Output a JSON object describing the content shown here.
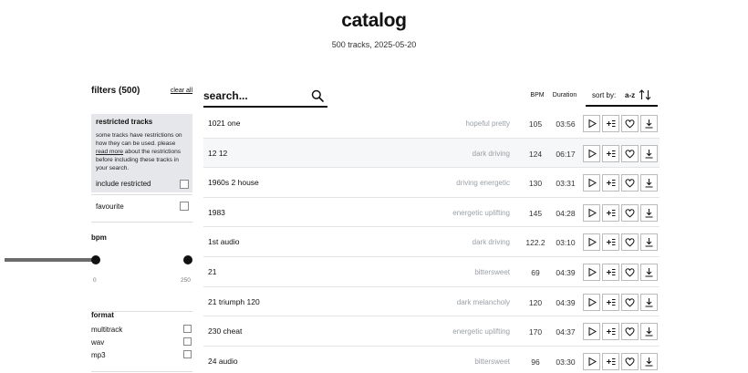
{
  "header": {
    "title": "catalog",
    "subtitle": "500 tracks, 2025-05-20"
  },
  "sidebar": {
    "filters_title": "filters (500)",
    "clear_all": "clear all",
    "restricted": {
      "title": "restricted tracks",
      "text_before": "some tracks have restrictions on how they can be used. please ",
      "link": "read more",
      "text_after": " about the restrictions before including these tracks in your search.",
      "include_label": "include restricted"
    },
    "favourite_label": "favourite",
    "bpm": {
      "title": "bpm",
      "min_label": "0",
      "max_label": "250",
      "range": [
        0,
        250
      ]
    },
    "format": {
      "title": "format",
      "options": [
        "multitrack",
        "wav",
        "mp3"
      ]
    }
  },
  "main": {
    "search_placeholder": "search...",
    "columns": {
      "bpm": "BPM",
      "duration": "Duration"
    },
    "sort": {
      "by_label": "sort by:",
      "value": "a-z"
    },
    "tracks": [
      {
        "name": "1021 one",
        "tags": "hopeful pretty",
        "bpm": "105",
        "duration": "03:56"
      },
      {
        "name": "12 12",
        "tags": "dark driving",
        "bpm": "124",
        "duration": "06:17"
      },
      {
        "name": "1960s 2 house",
        "tags": "driving energetic",
        "bpm": "130",
        "duration": "03:31"
      },
      {
        "name": "1983",
        "tags": "energetic uplifting",
        "bpm": "145",
        "duration": "04:28"
      },
      {
        "name": "1st audio",
        "tags": "dark driving",
        "bpm": "122.2",
        "duration": "03:10"
      },
      {
        "name": "21",
        "tags": "bittersweet",
        "bpm": "69",
        "duration": "04:39"
      },
      {
        "name": "21 triumph 120",
        "tags": "dark melancholy",
        "bpm": "120",
        "duration": "04:39"
      },
      {
        "name": "230 cheat",
        "tags": "energetic uplifting",
        "bpm": "170",
        "duration": "04:37"
      },
      {
        "name": "24 audio",
        "tags": "bittersweet",
        "bpm": "96",
        "duration": "03:30"
      }
    ]
  },
  "icons": {
    "search": "search-icon",
    "sort": "sort-arrows-icon",
    "play": "play-icon",
    "add_to_list": "add-to-list-icon",
    "favourite": "heart-icon",
    "download": "download-icon"
  },
  "colors": {
    "highlight_row": "#f6f7f8",
    "restricted_box": "#e6e7ea",
    "tag_text": "#9aa0a6",
    "slider_track": "#6b6b6b"
  }
}
